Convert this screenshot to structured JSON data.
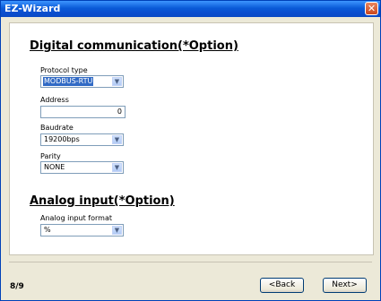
{
  "window": {
    "title": "EZ-Wizard",
    "close_glyph": "✕"
  },
  "digital": {
    "heading": "Digital communication(*Option)",
    "protocol": {
      "label": "Protocol type",
      "value": "MODBUS-RTU"
    },
    "address": {
      "label": "Address",
      "value": "0"
    },
    "baudrate": {
      "label": "Baudrate",
      "value": "19200bps"
    },
    "parity": {
      "label": "Parity",
      "value": "NONE"
    }
  },
  "analog": {
    "heading": "Analog input(*Option)",
    "format": {
      "label": "Analog input format",
      "value": "%"
    }
  },
  "footer": {
    "page": "8/9",
    "back_label": "<Back",
    "next_label": "Next>"
  },
  "icons": {
    "dropdown": "chevron-down-icon",
    "close": "close-icon"
  }
}
